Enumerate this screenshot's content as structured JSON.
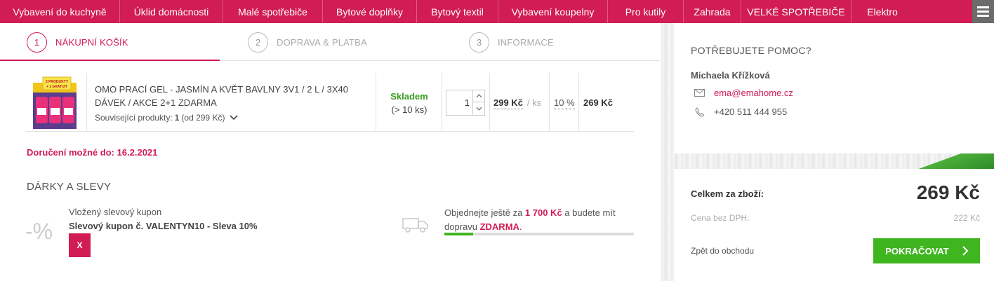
{
  "nav": {
    "items": [
      {
        "label": "Vybavení do kuchyně"
      },
      {
        "label": "Úklid domácnosti"
      },
      {
        "label": "Malé spotřebiče"
      },
      {
        "label": "Bytové doplňky"
      },
      {
        "label": "Bytový textil"
      },
      {
        "label": "Vybavení koupelny"
      },
      {
        "label": "Pro kutily"
      },
      {
        "label": "Zahrada"
      },
      {
        "label": "VELKÉ SPOTŘEBIČE"
      },
      {
        "label": "Elektro"
      }
    ],
    "menu_icon": "hamburger-icon"
  },
  "steps": [
    {
      "num": "1",
      "label": "NÁKUPNÍ KOŠÍK",
      "active": true
    },
    {
      "num": "2",
      "label": "DOPRAVA & PLATBA",
      "active": false
    },
    {
      "num": "3",
      "label": "INFORMACE",
      "active": false
    }
  ],
  "cart_item": {
    "name": "OMO PRACÍ GEL - JASMÍN A KVĚT BAVLNY 3V1 / 2 L / 3X40 DÁVEK / AKCE 2+1 ZDARMA",
    "related_label": "Související produkty:",
    "related_count": "1",
    "related_price": "(od 299 Kč)",
    "stock_status": "Skladem",
    "stock_qty": "(> 10 ks)",
    "quantity": "1",
    "unit_price": "299 Kč",
    "unit": "/ ks",
    "discount": "10 %",
    "total": "269 Kč",
    "image_badge": "3 PRODUKTY + 1 GRATUIT"
  },
  "delivery": "Doručení možné do: 16.2.2021",
  "gifts": {
    "title": "DÁRKY A SLEVY",
    "icon_text": "-%",
    "coupon_label": "Vložený slevový kupon",
    "coupon_value": "Slevový kupon č. VALENTYN10 - Sleva 10%",
    "remove_label": "X"
  },
  "shipping": {
    "text_before": "Objednejte ještě za ",
    "amount": "1 700 Kč",
    "text_middle": " a budete mít dopravu ",
    "free": "ZDARMA",
    "text_after": ".",
    "progress": 0.15
  },
  "help": {
    "title": "POTŘEBUJETE POMOC?",
    "name": "Michaela Křížková",
    "email": "ema@emahome.cz",
    "phone": "+420 511 444 955"
  },
  "summary": {
    "total_label": "Celkem za zboží:",
    "total_value": "269 Kč",
    "vat_label": "Cena bez DPH:",
    "vat_value": "222 Kč",
    "back_label": "Zpět do obchodu",
    "continue_label": "POKRAČOVAT"
  },
  "colors": {
    "brand": "#d11c55",
    "success": "#3fb51f"
  }
}
